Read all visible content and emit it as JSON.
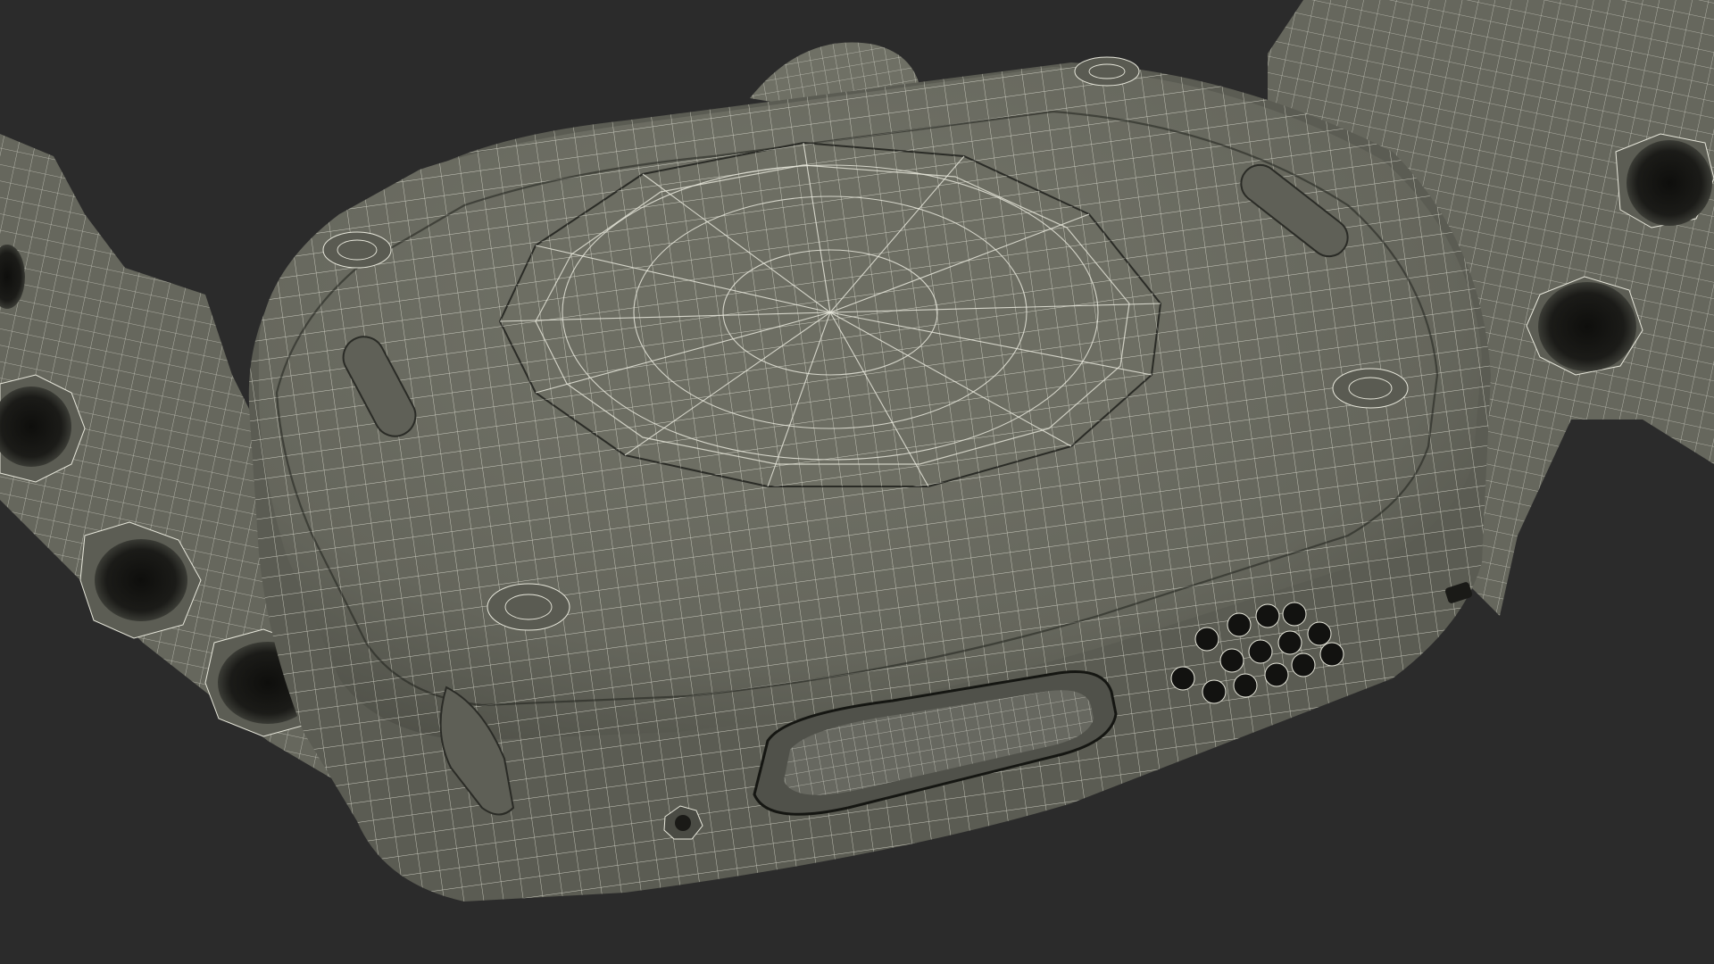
{
  "scene": {
    "subject_icon": "wireframe-smartwatch-icon",
    "background_color": "#2b2b2b",
    "mesh_fill_color": "#6e6f64",
    "mesh_shadow_color": "#4c4d45",
    "wire_color": "#e8e8dc"
  }
}
